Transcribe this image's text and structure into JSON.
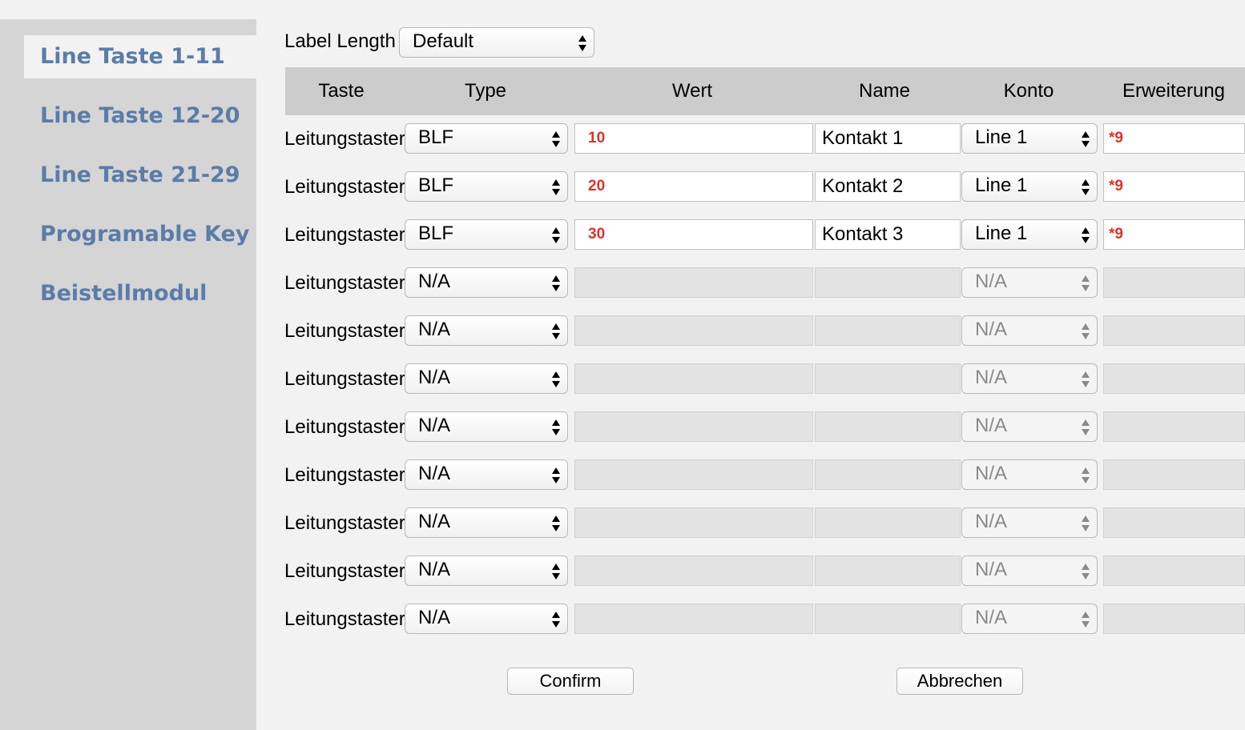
{
  "sidebar": {
    "items": [
      {
        "label": "Line Taste 1-11",
        "active": true
      },
      {
        "label": "Line Taste 12-20",
        "active": false
      },
      {
        "label": "Line Taste 21-29",
        "active": false
      },
      {
        "label": "Programable Key",
        "active": false
      },
      {
        "label": "Beistellmodul",
        "active": false
      }
    ]
  },
  "label_length": {
    "label": "Label Length",
    "value": "Default"
  },
  "table": {
    "headers": {
      "taste": "Taste",
      "type": "Type",
      "wert": "Wert",
      "name": "Name",
      "konto": "Konto",
      "erweiterung": "Erweiterung"
    },
    "rows": [
      {
        "taste": "Leitungstaster",
        "type": "BLF",
        "wert": "10",
        "name": "Kontakt 1",
        "konto": "Line 1",
        "erweiterung": "*9",
        "enabled": true
      },
      {
        "taste": "Leitungstaster",
        "type": "BLF",
        "wert": "20",
        "name": "Kontakt 2",
        "konto": "Line 1",
        "erweiterung": "*9",
        "enabled": true
      },
      {
        "taste": "Leitungstaster",
        "type": "BLF",
        "wert": "30",
        "name": "Kontakt 3",
        "konto": "Line 1",
        "erweiterung": "*9",
        "enabled": true
      },
      {
        "taste": "Leitungstaster",
        "type": "N/A",
        "wert": "",
        "name": "",
        "konto": "N/A",
        "erweiterung": "",
        "enabled": false
      },
      {
        "taste": "Leitungstaster",
        "type": "N/A",
        "wert": "",
        "name": "",
        "konto": "N/A",
        "erweiterung": "",
        "enabled": false
      },
      {
        "taste": "Leitungstaster",
        "type": "N/A",
        "wert": "",
        "name": "",
        "konto": "N/A",
        "erweiterung": "",
        "enabled": false
      },
      {
        "taste": "Leitungstaster",
        "type": "N/A",
        "wert": "",
        "name": "",
        "konto": "N/A",
        "erweiterung": "",
        "enabled": false
      },
      {
        "taste": "Leitungstaster",
        "type": "N/A",
        "wert": "",
        "name": "",
        "konto": "N/A",
        "erweiterung": "",
        "enabled": false
      },
      {
        "taste": "Leitungstaster",
        "type": "N/A",
        "wert": "",
        "name": "",
        "konto": "N/A",
        "erweiterung": "",
        "enabled": false
      },
      {
        "taste": "Leitungstaster",
        "type": "N/A",
        "wert": "",
        "name": "",
        "konto": "N/A",
        "erweiterung": "",
        "enabled": false
      },
      {
        "taste": "Leitungstaster",
        "type": "N/A",
        "wert": "",
        "name": "",
        "konto": "N/A",
        "erweiterung": "",
        "enabled": false
      }
    ]
  },
  "buttons": {
    "confirm": "Confirm",
    "cancel": "Abbrechen"
  },
  "colors": {
    "nav_link": "#5b7ca8",
    "value_red": "#e0302a",
    "header_bg": "#cccccc",
    "sidebar_bg": "#d5d5d5"
  }
}
